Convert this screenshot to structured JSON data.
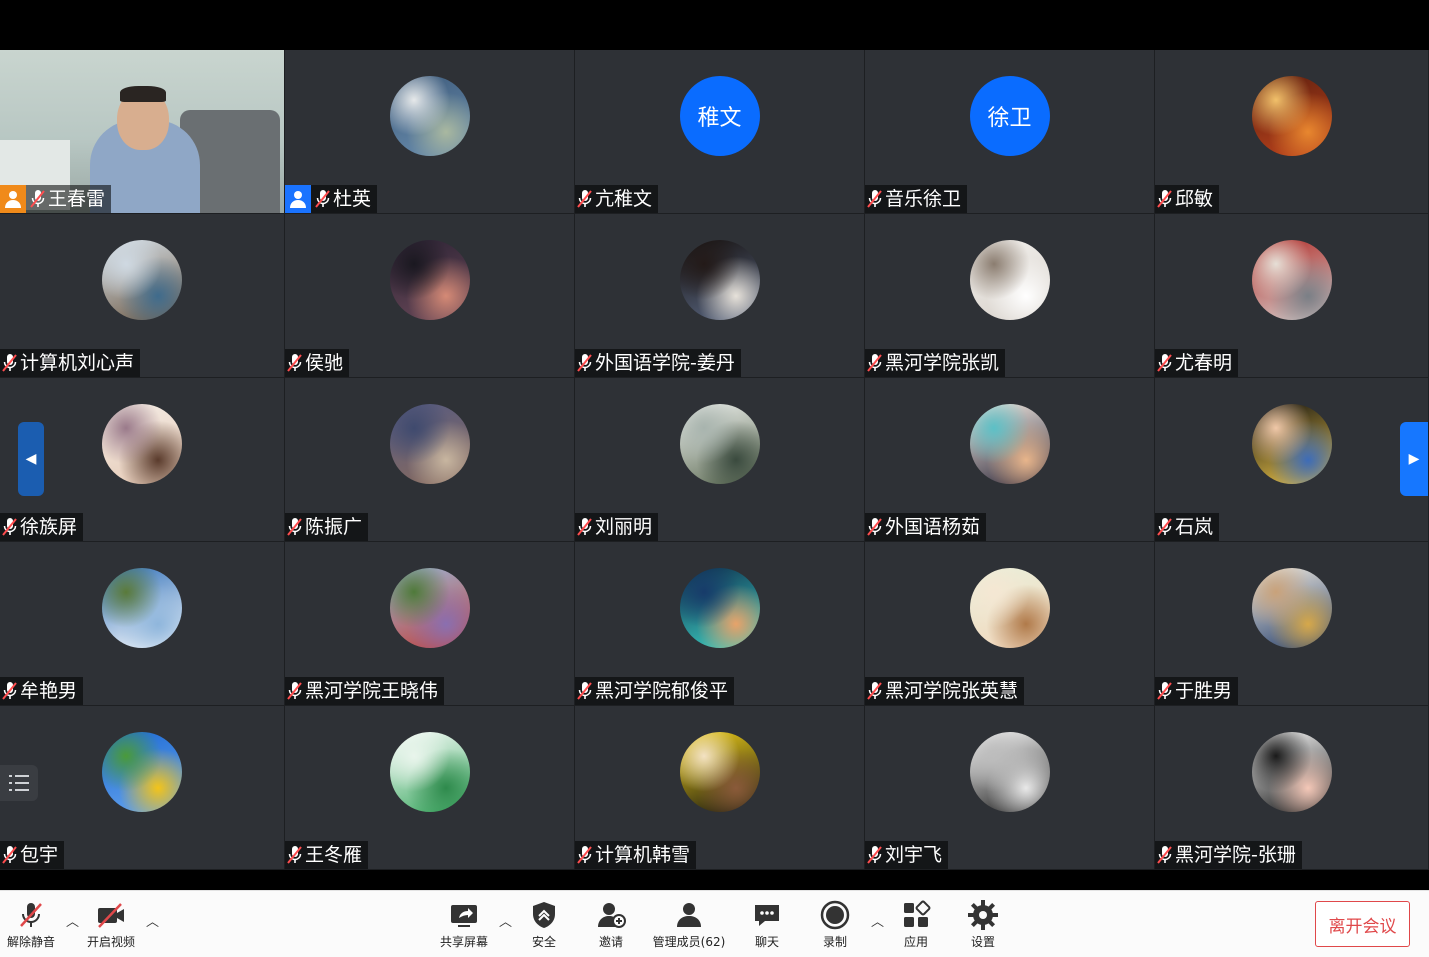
{
  "participants": [
    {
      "name": "王春雷",
      "type": "video",
      "host": "orange"
    },
    {
      "name": "杜英",
      "type": "image",
      "host": "blue",
      "palette": [
        "#3d5a7a",
        "#6b8fb0",
        "#a9b8a0",
        "#e6e9ea"
      ]
    },
    {
      "name": "亢稚文",
      "type": "text",
      "avatar_text": "稚文"
    },
    {
      "name": "音乐徐卫",
      "type": "text",
      "avatar_text": "徐卫"
    },
    {
      "name": "邱敏",
      "type": "image",
      "palette": [
        "#5a1e0e",
        "#c2451d",
        "#e8872f",
        "#f1c06a"
      ]
    },
    {
      "name": "计算机刘心声",
      "type": "image",
      "palette": [
        "#d8e3ec",
        "#6e5a45",
        "#3f6b8c",
        "#cfd9e2"
      ]
    },
    {
      "name": "侯驰",
      "type": "image",
      "palette": [
        "#2a2233",
        "#6c4a5a",
        "#d58a76",
        "#1a1820"
      ]
    },
    {
      "name": "外国语学院-姜丹",
      "type": "image",
      "palette": [
        "#15100e",
        "#5c6a86",
        "#e7e2da",
        "#231a18"
      ]
    },
    {
      "name": "黑河学院张凯",
      "type": "image",
      "palette": [
        "#f3f1ee",
        "#d7d1ca",
        "#ffffff",
        "#8b7d70"
      ]
    },
    {
      "name": "尤春明",
      "type": "image",
      "palette": [
        "#b02a26",
        "#d7d4d2",
        "#7a7f86",
        "#e6dfd6"
      ]
    },
    {
      "name": "徐族屏",
      "type": "image",
      "palette": [
        "#f5efe9",
        "#e4c7b2",
        "#5a3b2c",
        "#9a7a8a"
      ]
    },
    {
      "name": "陈振广",
      "type": "image",
      "palette": [
        "#545a82",
        "#8a6b5c",
        "#c8b6a0",
        "#3f4a6e"
      ]
    },
    {
      "name": "刘丽明",
      "type": "image",
      "palette": [
        "#f1f3f1",
        "#5b6a52",
        "#3a4a3e",
        "#a8b4ae"
      ]
    },
    {
      "name": "外国语杨茹",
      "type": "image",
      "palette": [
        "#f7efe6",
        "#2a2436",
        "#e8b58b",
        "#5cc0c6"
      ]
    },
    {
      "name": "石岚",
      "type": "image",
      "palette": [
        "#0f0f10",
        "#f2c94a",
        "#3d6cb8",
        "#f0c8a8"
      ]
    },
    {
      "name": "牟艳男",
      "type": "image",
      "palette": [
        "#2f6fb8",
        "#ffffff",
        "#8fb6dc",
        "#5a7a3a"
      ]
    },
    {
      "name": "黑河学院王晓伟",
      "type": "image",
      "palette": [
        "#9ab8d8",
        "#c2403a",
        "#8a6fb0",
        "#4f7a3a"
      ]
    },
    {
      "name": "黑河学院郁俊平",
      "type": "image",
      "palette": [
        "#0d2b4a",
        "#3fd7c9",
        "#e8a36a",
        "#173b6a"
      ]
    },
    {
      "name": "黑河学院张英慧",
      "type": "image",
      "palette": [
        "#e9f1dc",
        "#f3d6bb",
        "#b07a4a",
        "#f5e7d3"
      ]
    },
    {
      "name": "于胜男",
      "type": "image",
      "palette": [
        "#f6efe2",
        "#1f3a6a",
        "#d6a84a",
        "#c9a27a"
      ]
    },
    {
      "name": "包宇",
      "type": "image",
      "palette": [
        "#1a67d2",
        "#6aa8f0",
        "#f3c41a",
        "#4a9a3a"
      ]
    },
    {
      "name": "王冬雁",
      "type": "image",
      "palette": [
        "#ffffff",
        "#3aa860",
        "#2e8a4c",
        "#e9f5ec"
      ]
    },
    {
      "name": "计算机韩雪",
      "type": "image",
      "palette": [
        "#f4d21a",
        "#101010",
        "#8a5a3a",
        "#f3e2c3"
      ]
    },
    {
      "name": "刘宇飞",
      "type": "image",
      "palette": [
        "#ffffff",
        "#1a1a1a",
        "#e9e9e9",
        "#bdbdbd"
      ]
    },
    {
      "name": "黑河学院-张珊",
      "type": "image",
      "palette": [
        "#ffffff",
        "#101010",
        "#f4c8b8",
        "#1a1a1a"
      ]
    }
  ],
  "toolbar": {
    "unmute": "解除静音",
    "video": "开启视频",
    "share": "共享屏幕",
    "security": "安全",
    "invite": "邀请",
    "members": "管理成员(62)",
    "chat": "聊天",
    "record": "录制",
    "apps": "应用",
    "settings": "设置",
    "leave": "离开会议"
  },
  "colors": {
    "accent": "#1677ff",
    "leave": "#e0484a",
    "host": "#f08a1a",
    "avatar_text_bg": "#0a6cff"
  }
}
